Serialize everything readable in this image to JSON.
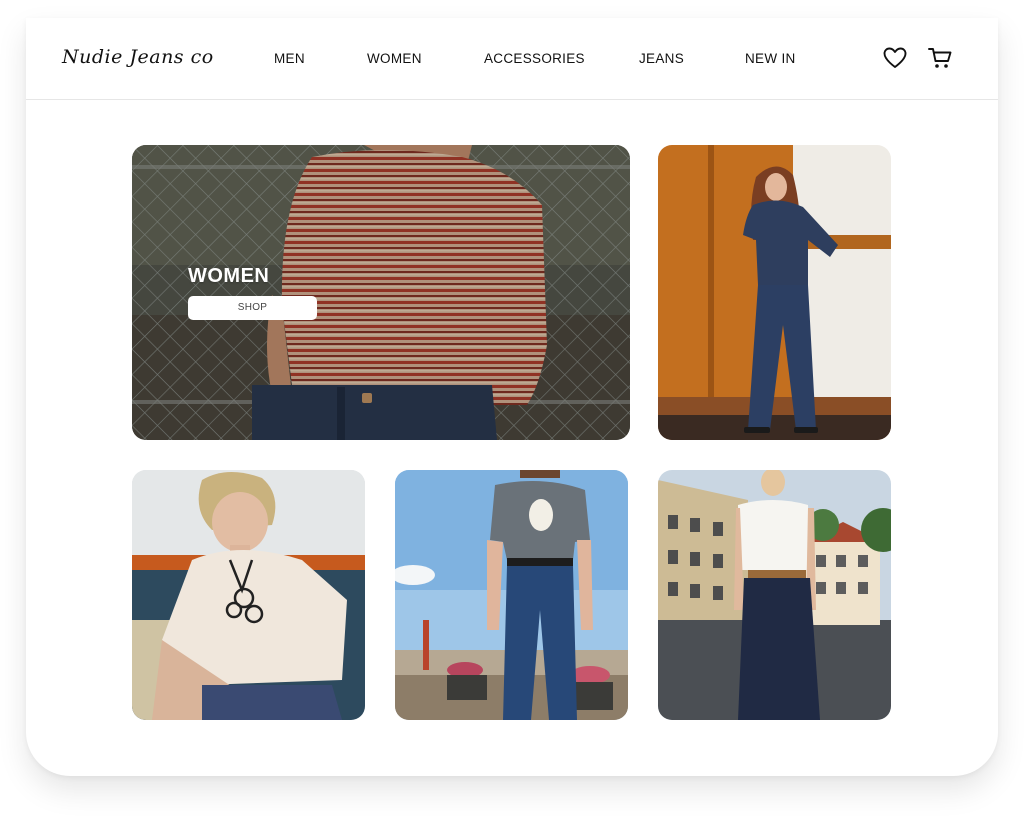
{
  "brand": {
    "logo_text": "Nudie Jeans co"
  },
  "nav": {
    "items": [
      {
        "label": "MEN"
      },
      {
        "label": "WOMEN"
      },
      {
        "label": "ACCESSORIES"
      },
      {
        "label": "JEANS"
      },
      {
        "label": "NEW IN"
      }
    ]
  },
  "header_icons": {
    "wishlist": "heart-icon",
    "cart": "cart-icon"
  },
  "hero": {
    "title": "WOMEN",
    "button_label": "SHOP"
  },
  "colors": {
    "text": "#111111",
    "divider": "#e6e6e6",
    "button_bg": "#ffffff"
  }
}
